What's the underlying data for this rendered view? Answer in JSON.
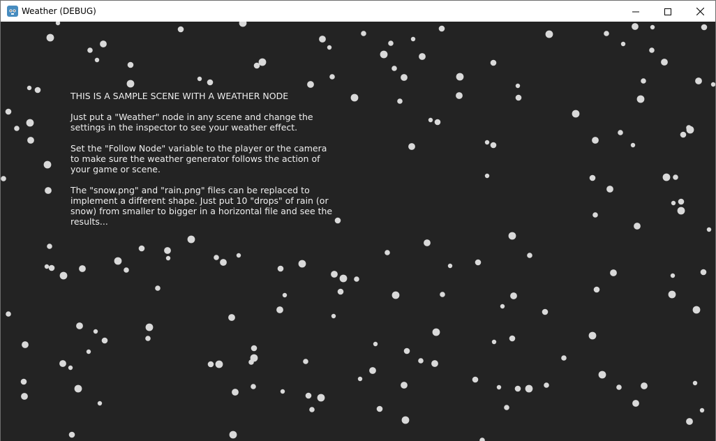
{
  "window": {
    "title": "Weather (DEBUG)",
    "icon": "godot-icon"
  },
  "controls": {
    "minimize_icon": "minimize-icon",
    "maximize_icon": "maximize-icon",
    "close_icon": "close-icon"
  },
  "colors": {
    "background": "#232323",
    "snowflake": "#d9d9d9",
    "text": "#efefef",
    "titlebar": "#ffffff"
  },
  "scene": {
    "heading": "THIS IS A SAMPLE SCENE WITH A WEATHER NODE",
    "paragraph_1": "Just put a \"Weather\" node in any scene and change the\nsettings in the inspector to see your weather effect.",
    "paragraph_2": "Set the \"Follow Node\" variable to the player or the camera\nto make sure the weather generator follows the action of\nyour game or scene.",
    "paragraph_3": "The \"snow.png\" and \"rain.png\" files can be replaced to\nimplement a different shape. Just put 10 \"drops\" of rain (or\nsnow) from smaller to bigger in a horizontal file and see the\nresults..."
  }
}
